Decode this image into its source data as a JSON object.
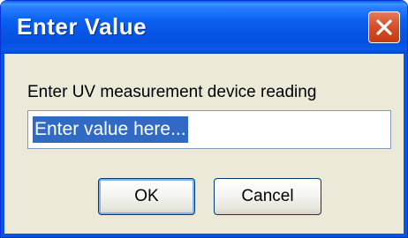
{
  "window": {
    "title": "Enter Value"
  },
  "dialog": {
    "prompt": "Enter UV measurement device reading",
    "input_value": "Enter value here...",
    "ok_label": "OK",
    "cancel_label": "Cancel"
  },
  "icons": {
    "close": "close-icon"
  },
  "colors": {
    "titlebar": "#0654e6",
    "close_button": "#d6512b",
    "dialog_background": "#ece9d8",
    "selection": "#316ac5"
  }
}
